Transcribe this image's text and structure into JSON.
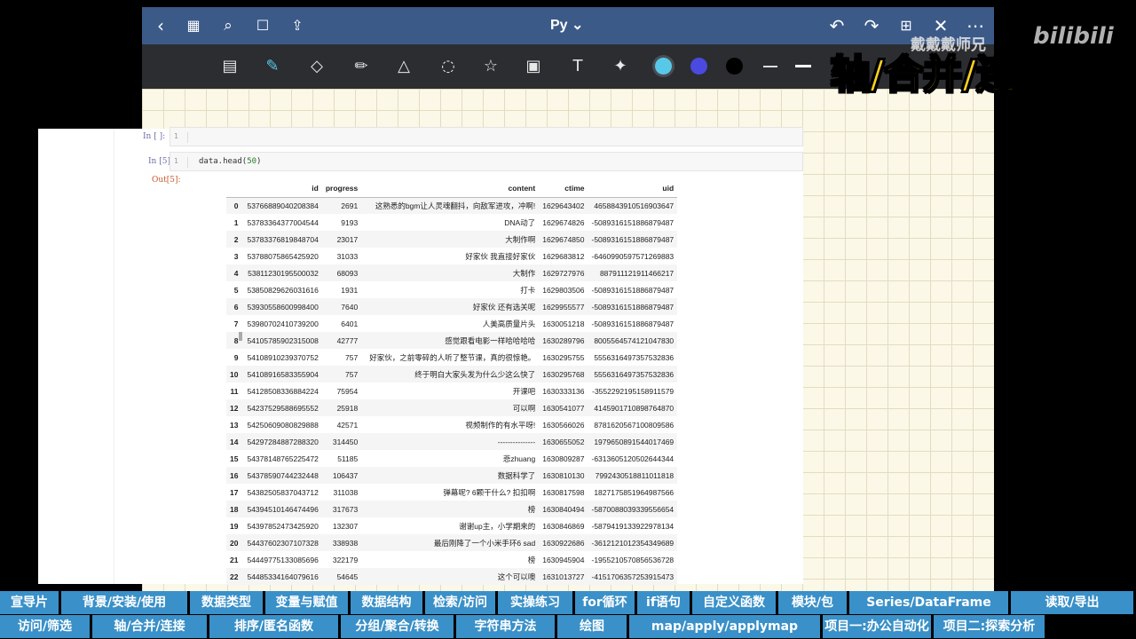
{
  "app": {
    "doc_title": "Py ⌄",
    "watermark_name": "戴戴戴师兄",
    "watermark_logo": "bilibili",
    "banner": "轴/合并/连接"
  },
  "notebook": {
    "cell1_prompt": "In  [  ]:",
    "cell1_line": "1",
    "cell2_prompt": "In  [5]:",
    "cell2_line": "1",
    "cell2_code_pre": "data.head(",
    "cell2_code_num": "50",
    "cell2_code_post": ")",
    "out_prompt": "Out[5]:"
  },
  "table": {
    "columns": [
      "",
      "id",
      "progress",
      "content",
      "ctime",
      "uid"
    ],
    "rows": [
      [
        "0",
        "53766889040208384",
        "2691",
        "这熟悉的bgm让人灵魂翻抖，向敌军进攻，冲啊!",
        "1629643402",
        "4658843910516903647"
      ],
      [
        "1",
        "53783364377004544",
        "9193",
        "DNA动了",
        "1629674826",
        "-5089316151886879487"
      ],
      [
        "2",
        "53783376819848704",
        "23017",
        "大制作啊",
        "1629674850",
        "-5089316151886879487"
      ],
      [
        "3",
        "53788075865425920",
        "31033",
        "好家伙 我直接好家伙",
        "1629683812",
        "-6460990597571269883"
      ],
      [
        "4",
        "53811230195500032",
        "68093",
        "大制作",
        "1629727976",
        "887911121911466217"
      ],
      [
        "5",
        "53850829626031616",
        "1931",
        "打卡",
        "1629803506",
        "-5089316151886879487"
      ],
      [
        "6",
        "53930558600998400",
        "7640",
        "好家伙 还有选关呢",
        "1629955577",
        "-5089316151886879487"
      ],
      [
        "7",
        "53980702410739200",
        "6401",
        "人美高质量片头",
        "1630051218",
        "-5089316151886879487"
      ],
      [
        "8",
        "54105785902315008",
        "42777",
        "感觉跟看电影一样哈哈哈哈",
        "1630289796",
        "8005564574121047830"
      ],
      [
        "9",
        "54108910239370752",
        "757",
        "好家伙，之前零碎的人听了整节课，真的很惊艳。",
        "1630295755",
        "5556316497357532836"
      ],
      [
        "10",
        "54108916583355904",
        "757",
        "终于明白大家头发为什么少这么快了",
        "1630295768",
        "5556316497357532836"
      ],
      [
        "11",
        "54128508336884224",
        "75954",
        "开课吧",
        "1630333136",
        "-3552292195158911579"
      ],
      [
        "12",
        "54237529588695552",
        "25918",
        "可以啊",
        "1630541077",
        "4145901710898764870"
      ],
      [
        "13",
        "54250609080829888",
        "42571",
        "视频制作的有水平呀!",
        "1630566026",
        "8781620567100809586"
      ],
      [
        "14",
        "54297284887288320",
        "314450",
        "---------------",
        "1630655052",
        "1979650891544017469"
      ],
      [
        "15",
        "54378148765225472",
        "51185",
        "悲zhuang",
        "1630809287",
        "-6313605120502644344"
      ],
      [
        "16",
        "54378590744232448",
        "106437",
        "数据科学了",
        "1630810130",
        "7992430518811011818"
      ],
      [
        "17",
        "54382505837043712",
        "311038",
        "弹幕呢? 6颗干什么? 扣扣啊",
        "1630817598",
        "1827175851964987566"
      ],
      [
        "18",
        "54394510146474496",
        "317673",
        "榜",
        "1630840494",
        "-5870088039339556654"
      ],
      [
        "19",
        "54397852473425920",
        "132307",
        "谢谢up主，小学期来的",
        "1630846869",
        "-5879419133922978134"
      ],
      [
        "20",
        "54437602307107328",
        "338938",
        "最后刚降了一个小米手环6 sad",
        "1630922686",
        "-3612121012354349689"
      ],
      [
        "21",
        "54449775133085696",
        "322179",
        "榜",
        "1630945904",
        "-1955210570856536728"
      ],
      [
        "22",
        "54485334164079616",
        "54645",
        "这个可以噢",
        "1631013727",
        "-4151706357253915473"
      ]
    ]
  },
  "nav": {
    "row1": [
      "宣导片",
      "背景/安装/使用",
      "数据类型",
      "变量与赋值",
      "数据结构",
      "检索/访问",
      "实操练习",
      "for循环",
      "if语句",
      "自定义函数",
      "模块/包",
      "Series/DataFrame",
      "读取/导出"
    ],
    "row2": [
      "访问/筛选",
      "轴/合并/连接",
      "排序/匿名函数",
      "分组/聚合/转换",
      "字符串方法",
      "绘图",
      "map/apply/applymap",
      "项目一:办公自动化",
      "项目二:探索分析"
    ]
  },
  "colors": {
    "topbar": "#3b5a88",
    "toolbar": "#2b2d31",
    "nav_chip": "#3a90c8",
    "banner_text": "#ffd21f",
    "pen_cyan": "#58c8e8",
    "pen_blue": "#4a4ae0",
    "pen_black": "#000000"
  },
  "icons": [
    "back-icon",
    "grid-icon",
    "search-icon",
    "bookmark-icon",
    "share-icon",
    "undo-icon",
    "redo-icon",
    "add-page-icon",
    "close-icon",
    "more-icon",
    "sidebar-icon",
    "pen-icon",
    "eraser-icon",
    "highlighter-icon",
    "shapes-icon",
    "lasso-icon",
    "sticker-icon",
    "image-icon",
    "text-icon",
    "laser-icon"
  ]
}
